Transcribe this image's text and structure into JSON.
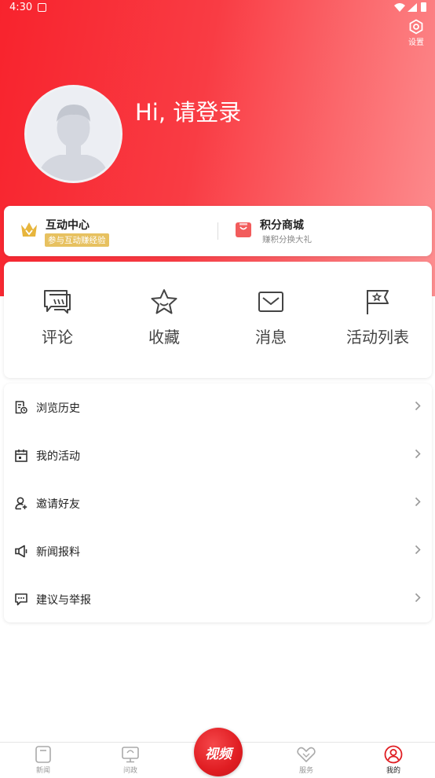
{
  "status_bar": {
    "time": "4:30"
  },
  "header": {
    "settings_label": "设置",
    "greeting": "Hi, 请登录"
  },
  "interaction": {
    "center_title": "互动中心",
    "center_badge": "参与互动赚经验",
    "mall_title": "积分商城",
    "mall_subtitle": "赚积分换大礼"
  },
  "quick_actions": [
    {
      "label": "评论",
      "icon": "comment-icon"
    },
    {
      "label": "收藏",
      "icon": "star-icon"
    },
    {
      "label": "消息",
      "icon": "mail-icon"
    },
    {
      "label": "活动列表",
      "icon": "flag-icon"
    }
  ],
  "menu": [
    {
      "label": "浏览历史",
      "icon": "history-icon"
    },
    {
      "label": "我的活动",
      "icon": "calendar-icon"
    },
    {
      "label": "邀请好友",
      "icon": "invite-user-icon"
    },
    {
      "label": "新闻报料",
      "icon": "megaphone-icon"
    },
    {
      "label": "建议与举报",
      "icon": "feedback-icon"
    }
  ],
  "tabbar": {
    "news": "新闻",
    "politics": "问政",
    "video": "视频",
    "service": "服务",
    "mine": "我的",
    "active": "mine"
  },
  "colors": {
    "brand_red": "#f8232d",
    "badge_gold": "#e7c160",
    "icon_gray": "#444444"
  }
}
